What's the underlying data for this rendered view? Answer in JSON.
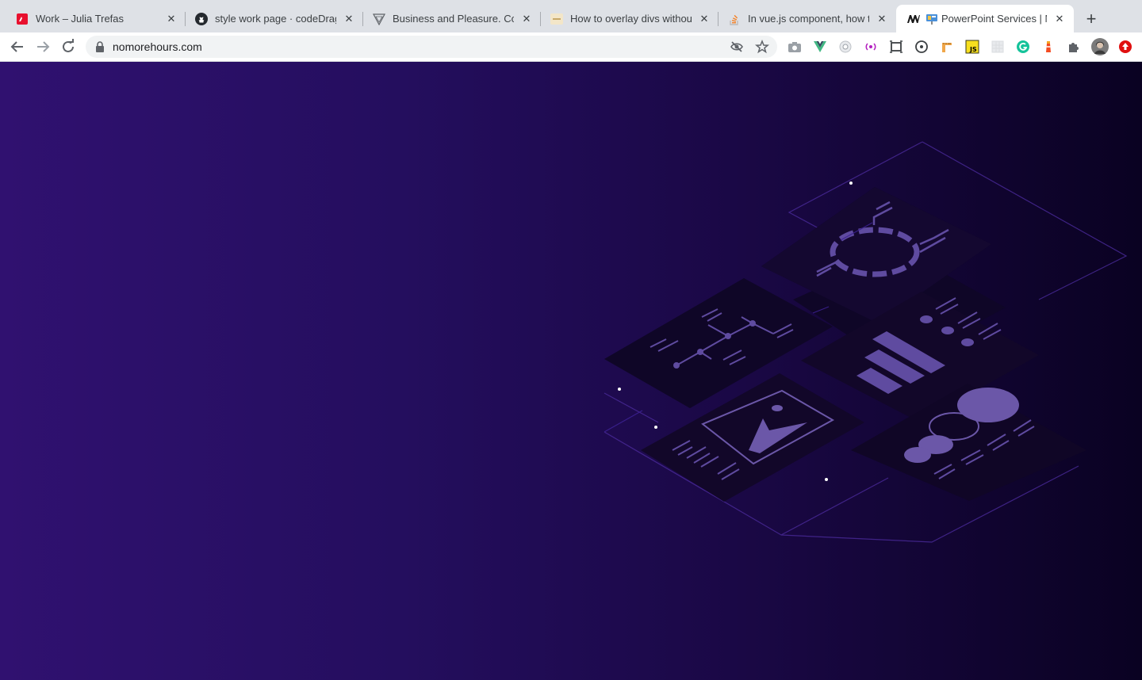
{
  "browser": {
    "tabs": [
      {
        "title": "Work – Julia Trefas",
        "icon": "adobe-red-icon",
        "active": false
      },
      {
        "title": "style work page · codeDrag…",
        "icon": "github-icon",
        "active": false
      },
      {
        "title": "Business and Pleasure. Com…",
        "icon": "triangle-logo-icon",
        "active": false
      },
      {
        "title": "How to overlay divs without…",
        "icon": "page-thumbnail-icon",
        "active": false
      },
      {
        "title": "In vue.js component, how to…",
        "icon": "stackoverflow-icon",
        "active": false
      },
      {
        "title": "PowerPoint Services | No…",
        "icon": "nmh-logo-icon",
        "active": true
      }
    ],
    "url": "nomorehours.com",
    "colors": {
      "tabbar": "#dee1e6",
      "active_tab": "#ffffff",
      "omnibox": "#f1f3f4"
    }
  },
  "page": {
    "gradient": [
      "#301170",
      "#240e5e",
      "#1a0845",
      "#0a0222"
    ],
    "illustration": "isometric-ui-panels-illustration"
  }
}
